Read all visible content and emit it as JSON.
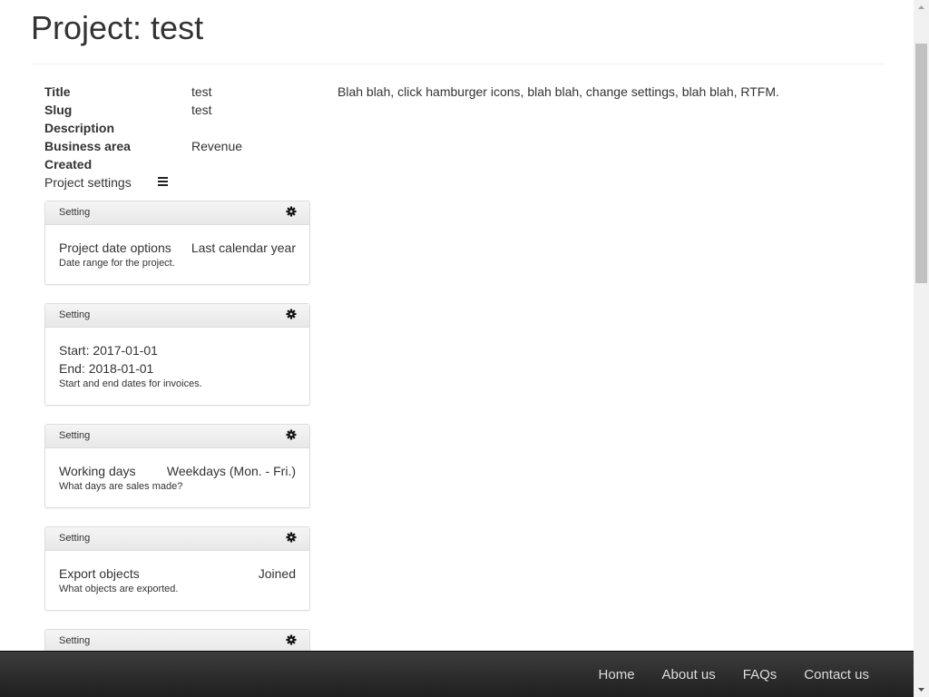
{
  "page": {
    "title": "Project: test"
  },
  "properties": [
    {
      "key": "Title",
      "value": "test"
    },
    {
      "key": "Slug",
      "value": "test"
    },
    {
      "key": "Description",
      "value": ""
    },
    {
      "key": "Business area",
      "value": "Revenue"
    },
    {
      "key": "Created",
      "value": ""
    }
  ],
  "project_settings": {
    "label": "Project settings",
    "menu_icon": "hamburger-icon"
  },
  "settings": [
    {
      "header": "Setting",
      "name": "Project date options",
      "value": "Last calendar year",
      "help": "Date range for the project."
    },
    {
      "header": "Setting",
      "start": "Start: 2017-01-01",
      "end": "End: 2018-01-01",
      "help": "Start and end dates for invoices."
    },
    {
      "header": "Setting",
      "name": "Working days",
      "value": "Weekdays (Mon. - Fri.)",
      "help": "What days are sales made?"
    },
    {
      "header": "Setting",
      "name": "Export objects",
      "value": "Joined",
      "help": "What objects are exported."
    },
    {
      "header": "Setting"
    }
  ],
  "note": "Blah blah, click hamburger icons, blah blah, change settings, blah blah, RTFM.",
  "footer": {
    "links": [
      "Home",
      "About us",
      "FAQs",
      "Contact us"
    ]
  },
  "colors": {
    "footer_bg": "#2b2b2b",
    "footer_text": "#dddddd",
    "card_border": "#dddddd",
    "card_head_bg": "#eeeeee"
  }
}
